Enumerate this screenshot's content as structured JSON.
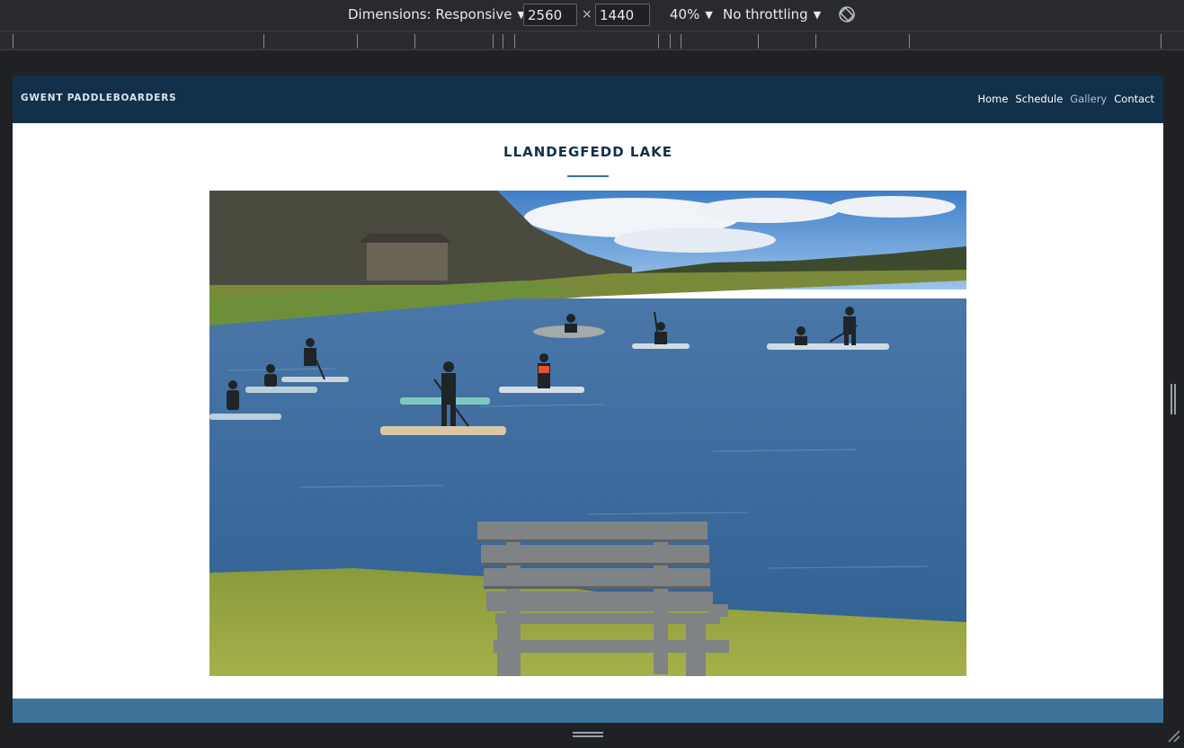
{
  "devtools": {
    "dimensions_label": "Dimensions: Responsive",
    "width_value": "2560",
    "times_sign": "×",
    "height_value": "1440",
    "zoom_label": "40%",
    "throttling_label": "No throttling",
    "rotate_icon": "rotate-icon"
  },
  "site": {
    "brand": "GWENT PADDLEBOARDERS",
    "nav": {
      "home": "Home",
      "schedule": "Schedule",
      "gallery": "Gallery",
      "contact": "Contact"
    },
    "active_nav": "Gallery",
    "page_title": "LLANDEGFEDD LAKE"
  },
  "colors": {
    "header_bg": "#13304a",
    "accent": "#3d7398",
    "footer_bg": "#3d7398"
  }
}
